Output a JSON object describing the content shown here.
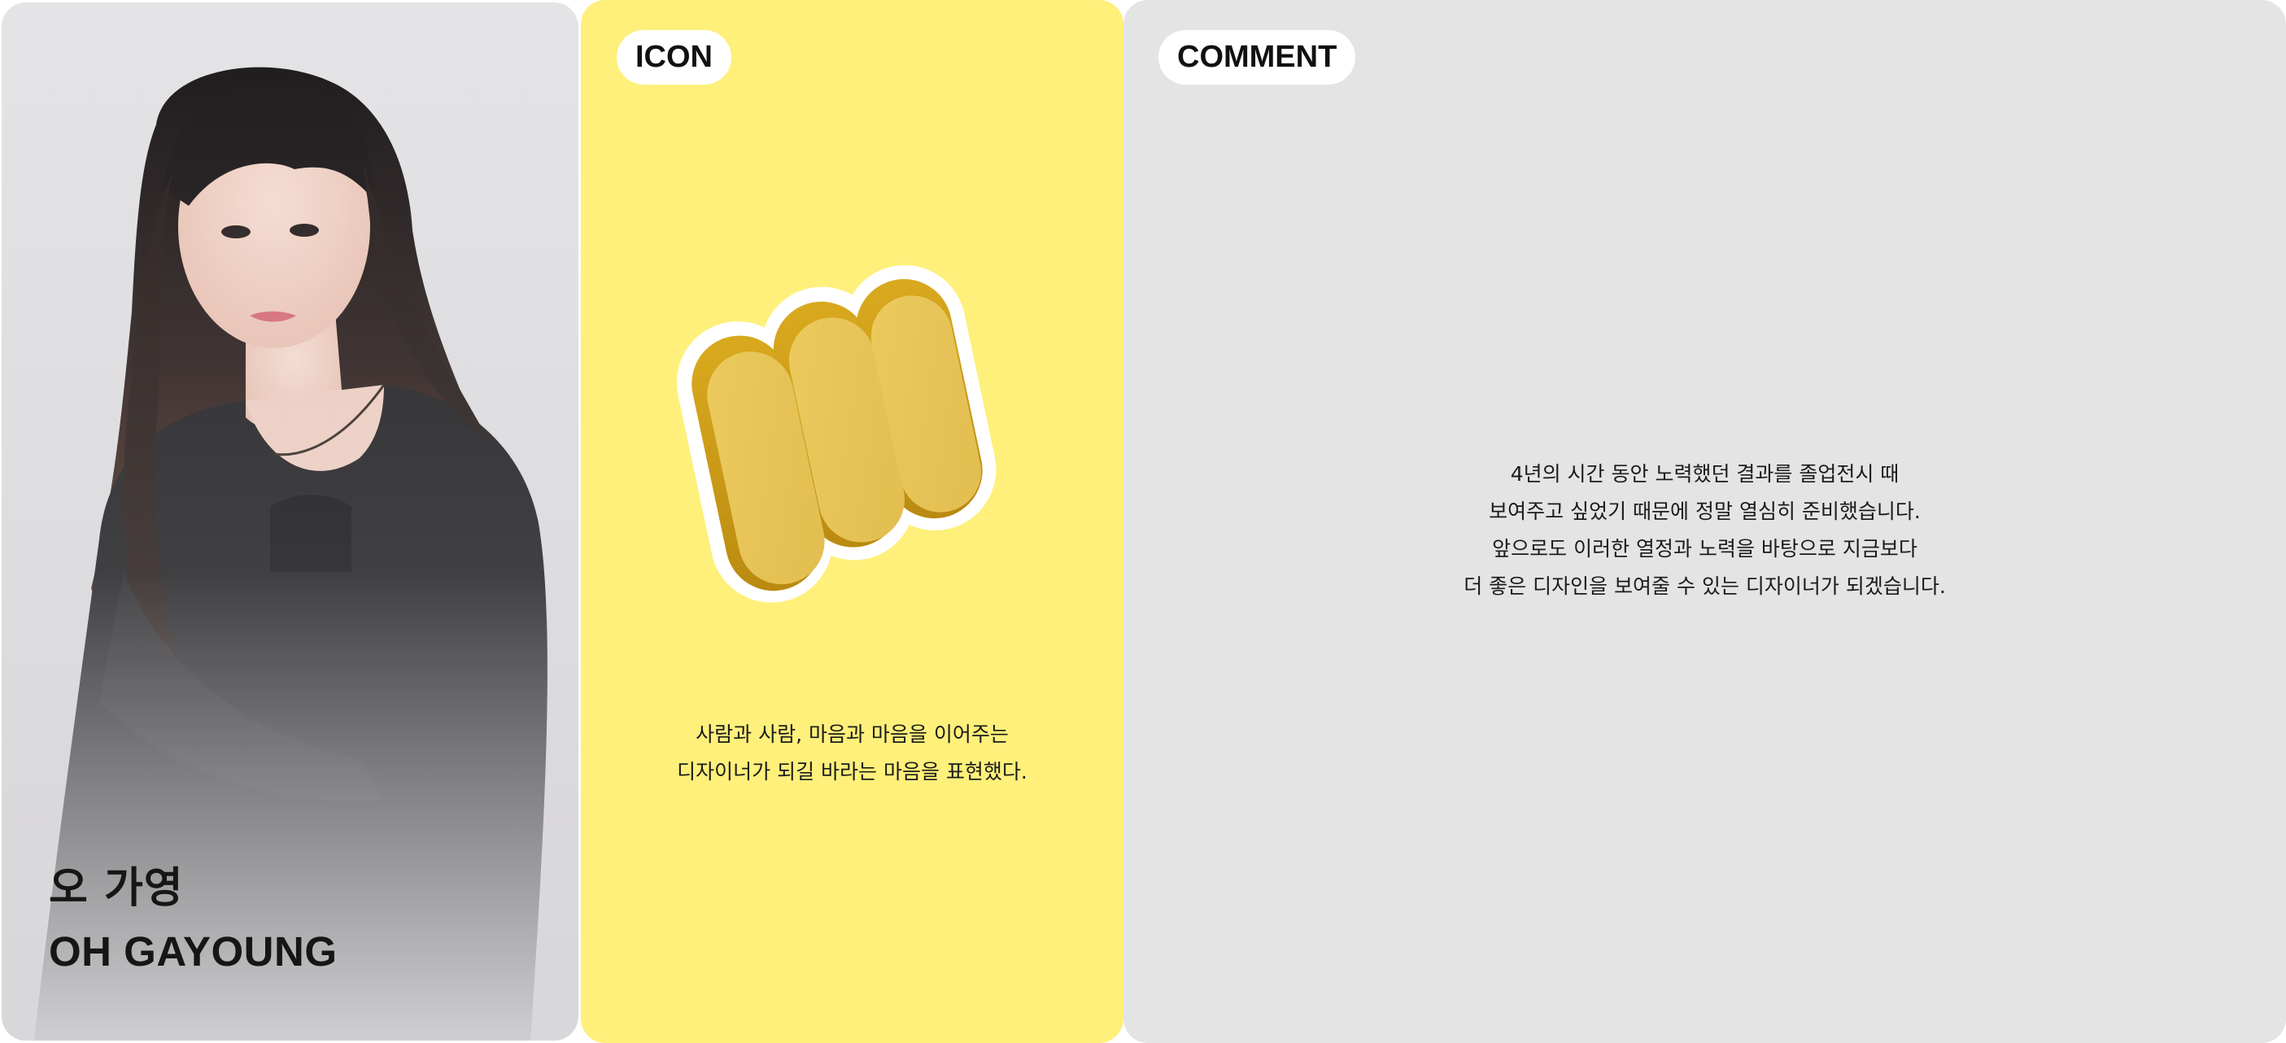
{
  "profile": {
    "name_kr": "오 가영",
    "name_en": "OH GAYOUNG"
  },
  "icon_section": {
    "badge": "ICON",
    "logo_icon": "yellow-3d-rounded-m-icon",
    "caption": [
      "사람과 사람, 마음과 마음을 이어주는",
      "디자이너가 되길 바라는 마음을 표현했다."
    ]
  },
  "comment_section": {
    "badge": "COMMENT",
    "text": [
      "4년의 시간 동안 노력했던 결과를 졸업전시 때",
      "보여주고 싶었기 때문에 정말 열심히 준비했습니다.",
      "앞으로도 이러한 열정과 노력을 바탕으로 지금보다",
      "더 좋은 디자인을 보여줄 수 있는 디자이너가 되겠습니다."
    ]
  },
  "colors": {
    "icon_card_bg": "#fef07a",
    "comment_card_bg": "#e4e4e4",
    "profile_card_bg": "#e0dfe1",
    "badge_bg": "#ffffff",
    "logo_gold": "#e6c15a"
  }
}
